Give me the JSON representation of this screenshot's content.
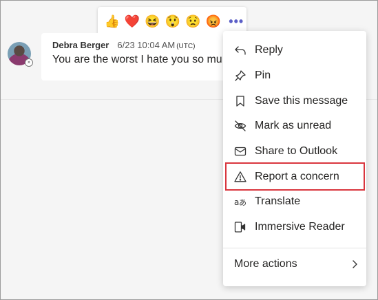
{
  "reactions": {
    "items": [
      {
        "name": "like",
        "glyph": "👍"
      },
      {
        "name": "heart",
        "glyph": "❤️"
      },
      {
        "name": "laugh",
        "glyph": "😆"
      },
      {
        "name": "surprised",
        "glyph": "😲"
      },
      {
        "name": "sad",
        "glyph": "😟"
      },
      {
        "name": "angry",
        "glyph": "😡"
      }
    ],
    "more_label": "•••"
  },
  "message": {
    "author": "Debra Berger",
    "time": "6/23 10:04 AM",
    "timezone": "(UTC)",
    "text": "You are the worst I hate you so mu",
    "status_glyph": "×"
  },
  "menu": {
    "items": [
      {
        "label": "Reply",
        "icon": "reply-icon"
      },
      {
        "label": "Pin",
        "icon": "pin-icon"
      },
      {
        "label": "Save this message",
        "icon": "bookmark-icon"
      },
      {
        "label": "Mark as unread",
        "icon": "unread-icon"
      },
      {
        "label": "Share to Outlook",
        "icon": "mail-icon"
      },
      {
        "label": "Report a concern",
        "icon": "warning-icon"
      },
      {
        "label": "Translate",
        "icon": "translate-icon"
      },
      {
        "label": "Immersive Reader",
        "icon": "reader-icon"
      }
    ],
    "more_actions": "More actions"
  },
  "colors": {
    "accent": "#5b5fc7",
    "highlight_border": "#d9363e",
    "background": "#f5f5f5"
  }
}
